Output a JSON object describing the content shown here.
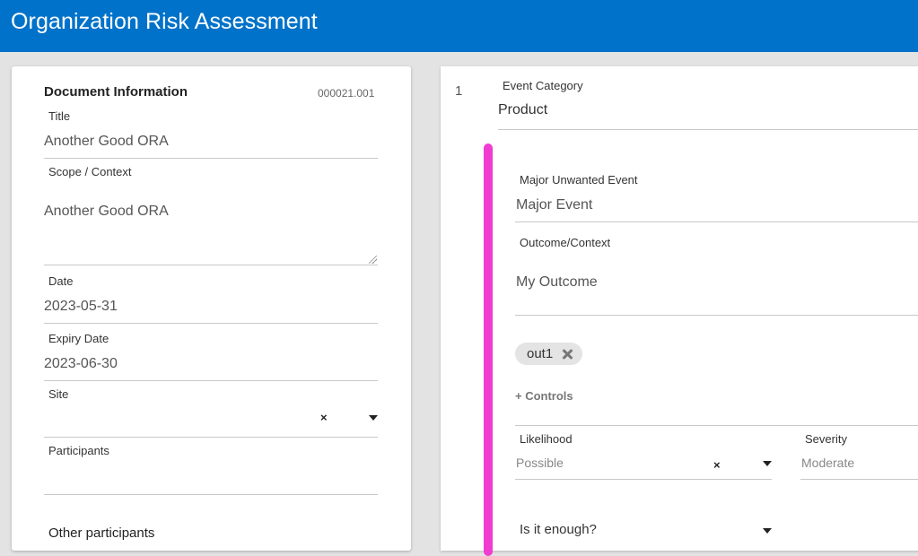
{
  "header": {
    "title": "Organization Risk Assessment"
  },
  "document": {
    "section_title": "Document Information",
    "number": "000021.001",
    "title_label": "Title",
    "title_value": "Another Good ORA",
    "scope_label": "Scope / Context",
    "scope_value": "Another Good ORA",
    "date_label": "Date",
    "date_value": "2023-05-31",
    "expiry_label": "Expiry Date",
    "expiry_value": "2023-06-30",
    "site_label": "Site",
    "site_clear": "×",
    "participants_label": "Participants",
    "other_participants_label": "Other participants"
  },
  "event": {
    "index": "1",
    "category_label": "Event Category",
    "category_value": "Product",
    "major_label": "Major Unwanted Event",
    "major_value": "Major Event",
    "outcome_label": "Outcome/Context",
    "outcome_value": "My Outcome",
    "chip_label": "out1",
    "add_controls": "+ Controls",
    "likelihood_label": "Likelihood",
    "likelihood_value": "Possible",
    "likelihood_clear": "×",
    "severity_label": "Severity",
    "severity_value": "Moderate",
    "enough_label": "Is it enough?"
  },
  "colors": {
    "header_bg": "#0072c9",
    "accent_bar": "#f03cd0",
    "page_bg": "#e3e3e3"
  },
  "icons": [
    "clear-icon",
    "dropdown-caret-icon",
    "chip-remove-icon",
    "resize-grip-icon"
  ]
}
